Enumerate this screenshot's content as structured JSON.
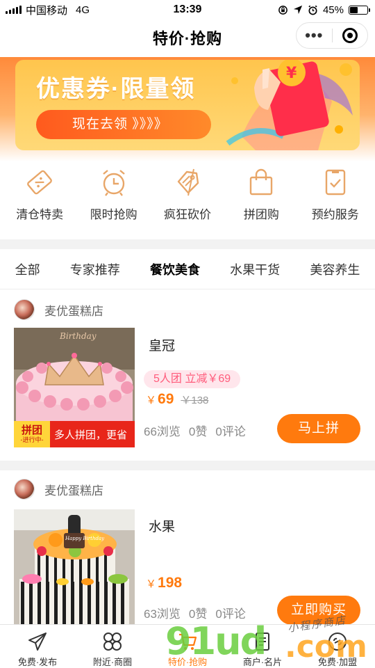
{
  "status_bar": {
    "carrier": "中国移动",
    "network": "4G",
    "time": "13:39",
    "battery_text": "45%",
    "battery_level": 0.45,
    "icons": [
      "signal-icon",
      "orientation-lock-icon",
      "location-icon",
      "alarm-icon",
      "battery-icon"
    ]
  },
  "nav": {
    "title": "特价·抢购",
    "more_label": "•••"
  },
  "banner": {
    "title": "优惠券·限量领",
    "button_label": "现在去领 》》》》"
  },
  "categories": [
    {
      "label": "清仓特卖",
      "icon": "coupon-icon"
    },
    {
      "label": "限时抢购",
      "icon": "alarm-clock-icon"
    },
    {
      "label": "疯狂砍价",
      "icon": "price-tag-icon"
    },
    {
      "label": "拼团购",
      "icon": "shopping-bag-icon"
    },
    {
      "label": "预约服务",
      "icon": "appointment-icon"
    }
  ],
  "tabs": [
    {
      "label": "全部",
      "active": false
    },
    {
      "label": "专家推荐",
      "active": false
    },
    {
      "label": "餐饮美食",
      "active": true
    },
    {
      "label": "水果干货",
      "active": false
    },
    {
      "label": "美容养生",
      "active": false
    }
  ],
  "products": [
    {
      "shop": "麦优蛋糕店",
      "title": "皇冠",
      "promo": "5人团 立减￥69",
      "currency": "￥",
      "price": "69",
      "orig_price": "￥138",
      "views": "66浏览",
      "likes": "0赞",
      "comments": "0评论",
      "button": "马上拼",
      "badge_main": "拼团",
      "badge_sub": "-进行中-",
      "badge_text": "多人拼团，更省",
      "image_text": "Birthday"
    },
    {
      "shop": "麦优蛋糕店",
      "title": "水果",
      "currency": "￥",
      "price": "198",
      "views": "63浏览",
      "likes": "0赞",
      "comments": "0评论",
      "button": "立即购买",
      "image_text": "Happy Birthday"
    }
  ],
  "bottom_nav": [
    {
      "label": "免费·发布",
      "icon": "paper-plane-icon",
      "active": false
    },
    {
      "label": "附近·商圈",
      "icon": "grid-circles-icon",
      "active": false
    },
    {
      "label": "特价·抢购",
      "icon": "shopping-cart-icon",
      "active": true
    },
    {
      "label": "商户·名片",
      "icon": "card-icon",
      "active": false
    },
    {
      "label": "免费·加盟",
      "icon": "link-icon",
      "active": false
    }
  ],
  "watermark": {
    "main": "91ud",
    "com": ".com",
    "script": "小程序商店"
  },
  "colors": {
    "accent": "#ff7a0e",
    "promo_bg": "#ffe6ec",
    "promo_text": "#ff5c7c",
    "category_icon": "#e8a668"
  }
}
